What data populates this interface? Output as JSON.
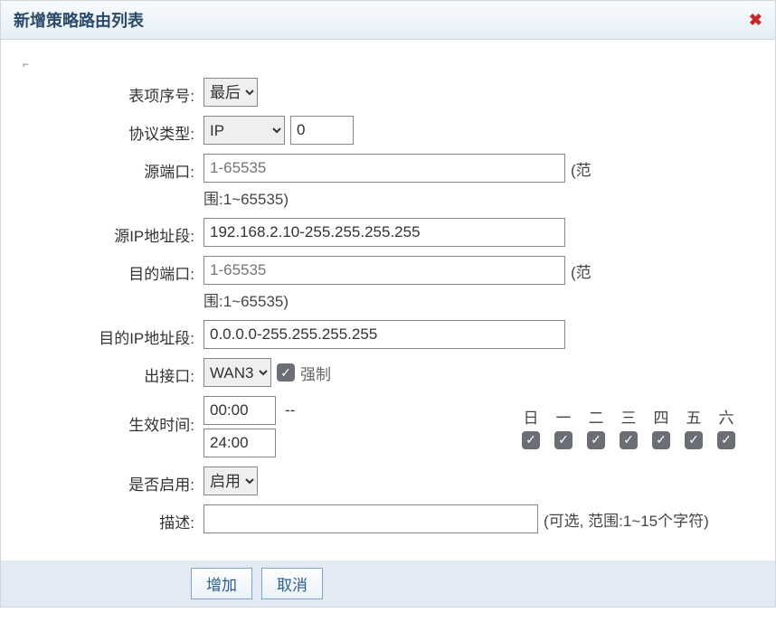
{
  "dialog": {
    "title": "新增策略路由列表"
  },
  "labels": {
    "index": "表项序号:",
    "protocol": "协议类型:",
    "srcPort": "源端口:",
    "srcIp": "源IP地址段:",
    "dstPort": "目的端口:",
    "dstIp": "目的IP地址段:",
    "outIf": "出接口:",
    "time": "生效时间:",
    "enable": "是否启用:",
    "desc": "描述:"
  },
  "values": {
    "index": "最后",
    "protocol": "IP",
    "protocolNum": "0",
    "srcPortPlaceholder": "1-65535",
    "portRangeHint": "(范围:1~65535)",
    "srcIp": "192.168.2.10-255.255.255.255",
    "dstPortPlaceholder": "1-65535",
    "dstIp": "0.0.0.0-255.255.255.255",
    "outIf": "WAN3",
    "forceLabel": "强制",
    "timeStart": "00:00",
    "timeEnd": "24:00",
    "timeDash": "--",
    "enable": "启用",
    "desc": "",
    "descHint": "(可选, 范围:1~15个字符)"
  },
  "days": {
    "d0": "日",
    "d1": "一",
    "d2": "二",
    "d3": "三",
    "d4": "四",
    "d5": "五",
    "d6": "六"
  },
  "buttons": {
    "add": "增加",
    "cancel": "取消"
  },
  "check": "✓"
}
